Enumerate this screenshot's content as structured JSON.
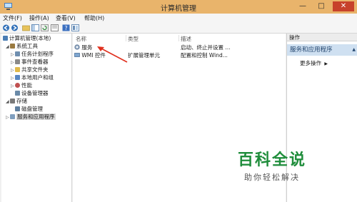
{
  "window": {
    "title": "计算机管理"
  },
  "title_buttons": {
    "minimize": "—",
    "maximize": "□",
    "close": "✕"
  },
  "menu": [
    {
      "label": "文件(F)"
    },
    {
      "label": "操作(A)"
    },
    {
      "label": "查看(V)"
    },
    {
      "label": "帮助(H)"
    }
  ],
  "toolbar": {
    "buttons": [
      "back-icon",
      "forward-icon",
      "up-folder-icon",
      "show-tree-icon",
      "refresh-icon",
      "export-icon",
      "help-icon",
      "properties-icon"
    ]
  },
  "tree": {
    "items": [
      {
        "label": "计算机管理(本地)",
        "arrow": "",
        "icon": "computer-icon",
        "color": "#4a7db4"
      },
      {
        "label": "系统工具",
        "arrow": "◢",
        "icon": "tools-icon",
        "color": "#9a7a40"
      },
      {
        "label": "任务计划程序",
        "arrow": "▷",
        "icon": "clock-icon",
        "color": "#6f8fb0"
      },
      {
        "label": "事件查看器",
        "arrow": "▷",
        "icon": "event-icon",
        "color": "#8a8a8a"
      },
      {
        "label": "共享文件夹",
        "arrow": "▷",
        "icon": "folder-icon",
        "color": "#e0b94a"
      },
      {
        "label": "本地用户和组",
        "arrow": "▷",
        "icon": "users-icon",
        "color": "#5a88c2"
      },
      {
        "label": "性能",
        "arrow": "▷",
        "icon": "performance-icon",
        "color": "#c05050"
      },
      {
        "label": "设备管理器",
        "arrow": "",
        "icon": "device-icon",
        "color": "#6a8aa8"
      },
      {
        "label": "存储",
        "arrow": "◢",
        "icon": "storage-icon",
        "color": "#7a7a7a"
      },
      {
        "label": "磁盘管理",
        "arrow": "",
        "icon": "disk-icon",
        "color": "#5f7f9f"
      },
      {
        "label": "服务和应用程序",
        "arrow": "▷",
        "icon": "services-apps-icon",
        "color": "#7f9fbf"
      }
    ]
  },
  "list": {
    "columns": [
      "名称",
      "类型",
      "描述"
    ],
    "rows": [
      {
        "name": "服务",
        "type": "",
        "desc": "启动、终止并设置 ...",
        "icon": "services-icon"
      },
      {
        "name": "WMI 控件",
        "type": "扩展管理单元",
        "desc": "配置和控制 Wind...",
        "icon": "wmi-icon"
      }
    ]
  },
  "actions": {
    "header": "操作",
    "section": "服务和应用程序",
    "section_arrow": "▲",
    "more": "更多操作",
    "more_arrow": "▶"
  },
  "watermark": {
    "title": "百科全说",
    "subtitle": "助你轻松解决"
  },
  "colors": {
    "titlebar": "#e9b46b",
    "close": "#c7422b",
    "accent": "#cfe0f1",
    "watermark": "#1f8d3b",
    "pointer_arrow": "#e0301e"
  }
}
